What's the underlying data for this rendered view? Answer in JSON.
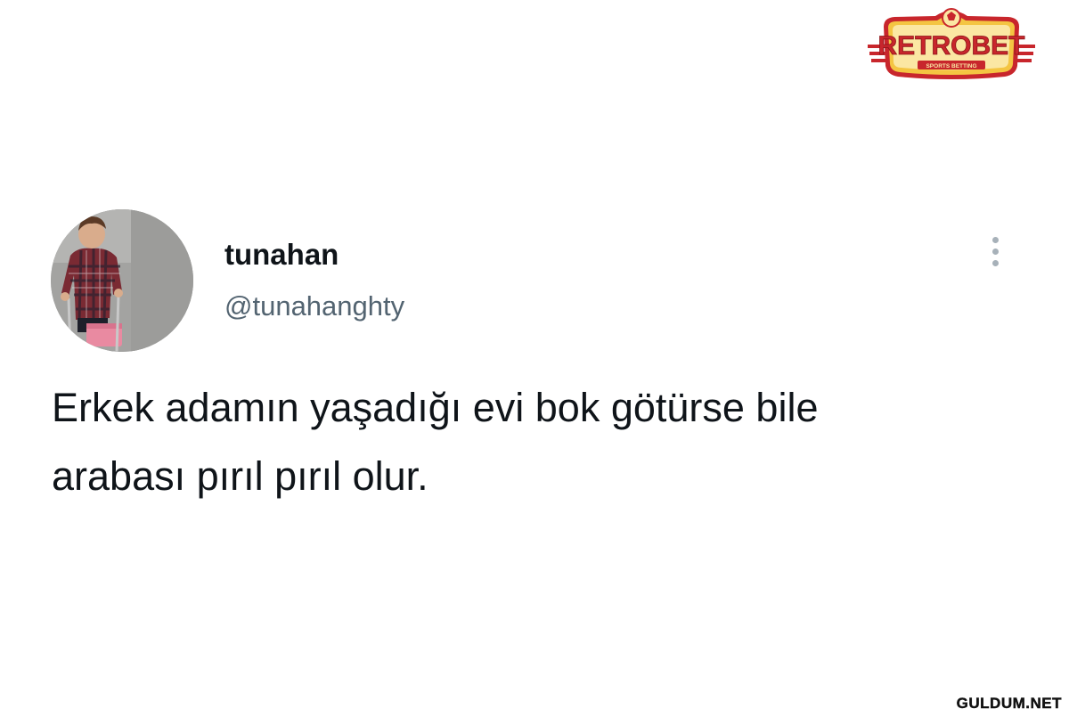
{
  "brand": {
    "name": "RETROBET",
    "tagline": "SPORTS BETTING",
    "colors": {
      "red": "#c8262c",
      "gold": "#f4c542",
      "cream": "#fbe7a3"
    }
  },
  "tweet": {
    "display_name": "tunahan",
    "handle": "@tunahanghty",
    "text_lines": [
      "Erkek adamın yaşadığı evi bok götürse bile",
      "arabası pırıl pırıl olur."
    ],
    "more_icon": "more-vertical-icon"
  },
  "watermark": {
    "text": "GULDUM.NET"
  },
  "colors": {
    "text_primary": "#0f1419",
    "text_secondary": "#536471",
    "background": "#ffffff"
  }
}
